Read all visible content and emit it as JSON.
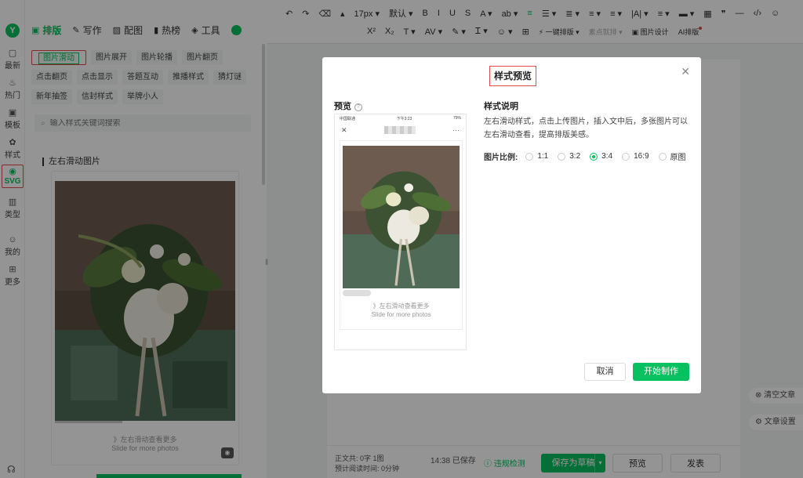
{
  "rail": {
    "items": [
      {
        "label": "最新",
        "icon": "chat-icon"
      },
      {
        "label": "热门",
        "icon": "flame-icon"
      },
      {
        "label": "模板",
        "icon": "template-icon"
      },
      {
        "label": "样式",
        "icon": "style-icon"
      },
      {
        "label": "SVG",
        "icon": "svg-icon"
      },
      {
        "label": "类型",
        "icon": "book-icon"
      },
      {
        "label": "我的",
        "icon": "user-icon"
      },
      {
        "label": "更多",
        "icon": "grid-icon"
      }
    ]
  },
  "tabs": [
    {
      "label": "排版",
      "icon": "layout-icon",
      "active": true
    },
    {
      "label": "写作",
      "icon": "pen-icon"
    },
    {
      "label": "配图",
      "icon": "image-icon"
    },
    {
      "label": "热榜",
      "icon": "bookmark-icon"
    },
    {
      "label": "工具",
      "icon": "cube-icon"
    }
  ],
  "tags": [
    "图片滑动",
    "图片展开",
    "图片轮播",
    "图片翻页",
    "点击翻页",
    "点击显示",
    "答题互动",
    "推播样式",
    "猜灯谜",
    "新年抽签",
    "信封样式",
    "举牌小人"
  ],
  "search": {
    "placeholder": "输入样式关键词搜索"
  },
  "section_title": "左右滑动图片",
  "card": {
    "caption1": "》左右滑动查看更多",
    "caption2": "Slide for more photos"
  },
  "toolbar": {
    "row1": [
      "↶",
      "↷",
      "⌫",
      "▴",
      "17px ▾",
      "默认 ▾",
      "B",
      "I",
      "U",
      "S",
      "A ▾",
      "ab ▾",
      "≡",
      "☰ ▾",
      "≣ ▾",
      "≡ ▾",
      "≡ ▾",
      "|A| ▾",
      "≡ ▾",
      "▬ ▾",
      "▦",
      "❞",
      "—",
      "‹/›",
      "☺"
    ],
    "row2": [
      "X²",
      "X₂",
      "T ▾",
      "AV ▾",
      "✎ ▾",
      "Ꮖ ▾",
      "☺ ▾",
      "⊞",
      "⚡ 一键排版 ▾",
      "素点就排 ▾",
      "▣ 图片设计",
      "AI排版"
    ]
  },
  "bottom": {
    "stats_line1": "正文共: 0字 1图",
    "stats_line2": "预计阅读时间: 0分钟",
    "time_saved": "14:38 已保存",
    "check": "违规检测",
    "save_draft": "保存为草稿",
    "preview": "预览",
    "publish": "发表"
  },
  "side_buttons": [
    "清空文章",
    "文章设置"
  ],
  "dialog": {
    "title": "样式预览",
    "preview_label": "预览",
    "phone_status_left": "中国联通",
    "phone_status_mid": "下午3:23",
    "phone_status_right": "79%",
    "phone_caption1": "》左右滑动查看更多",
    "phone_caption2": "Slide for more photos",
    "desc_label": "样式说明",
    "desc_text": "左右滑动样式，点击上传图片，插入文中后，多张图片可以左右滑动查看，提高排版美感。",
    "ratio_label": "图片比例:",
    "ratios": [
      "1:1",
      "3:2",
      "3:4",
      "16:9",
      "原图"
    ],
    "ratio_selected": "3:4",
    "cancel": "取消",
    "start": "开始制作"
  }
}
